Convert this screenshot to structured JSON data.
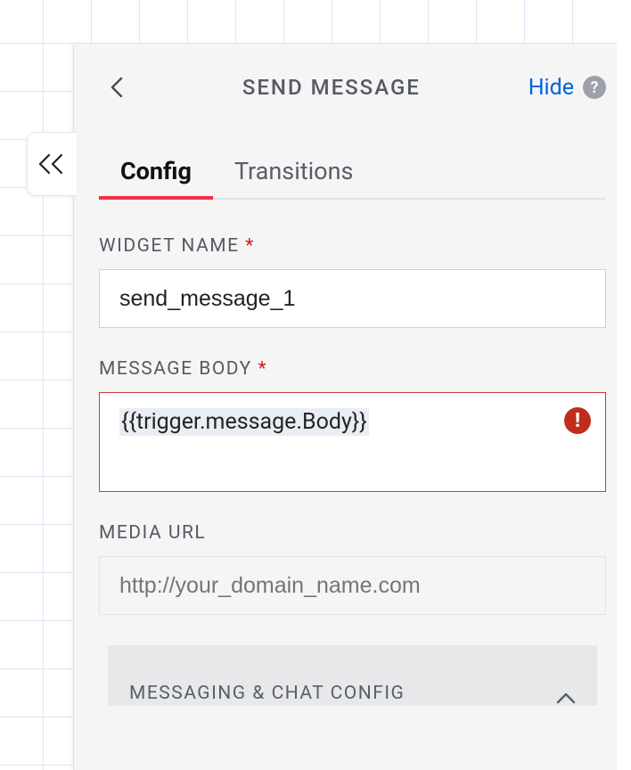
{
  "header": {
    "title": "SEND MESSAGE",
    "hide_label": "Hide",
    "help_symbol": "?"
  },
  "tabs": {
    "config": "Config",
    "transitions": "Transitions",
    "active": "config"
  },
  "form": {
    "widget_name": {
      "label": "WIDGET NAME",
      "required_mark": "*",
      "value": "send_message_1"
    },
    "message_body": {
      "label": "MESSAGE BODY",
      "required_mark": "*",
      "value": "{{trigger.message.Body}}",
      "error_symbol": "!"
    },
    "media_url": {
      "label": "MEDIA URL",
      "placeholder": "http://your_domain_name.com",
      "value": ""
    }
  },
  "accordion": {
    "title": "MESSAGING & CHAT CONFIG"
  }
}
